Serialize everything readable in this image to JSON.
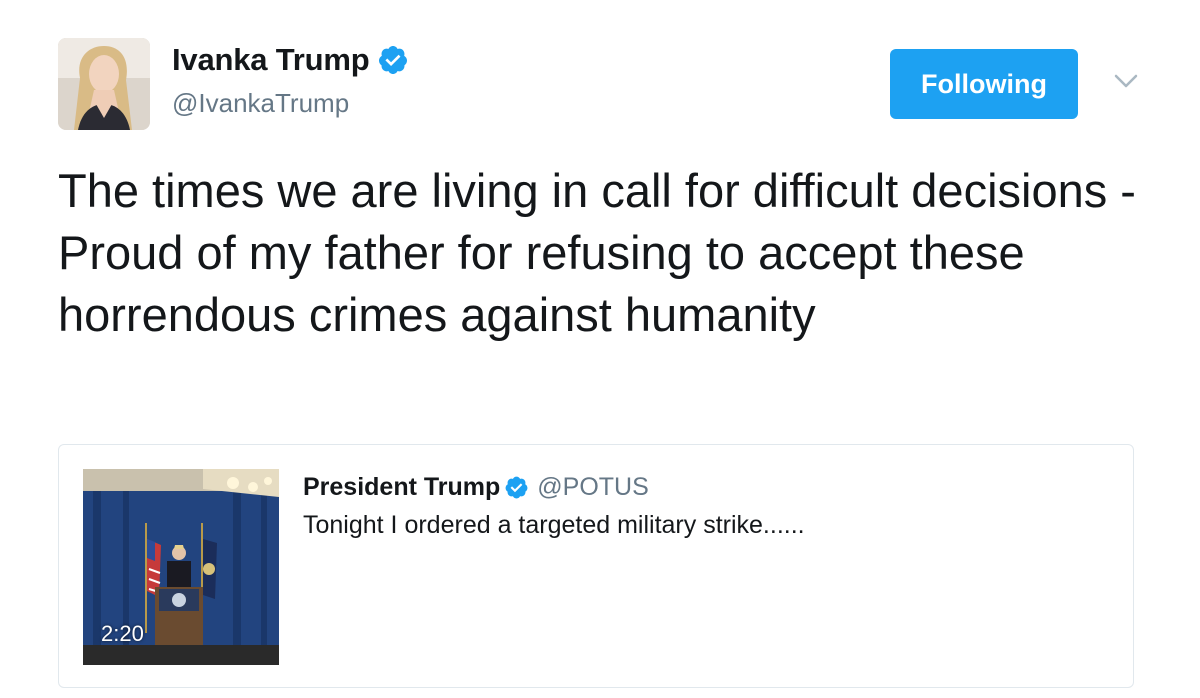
{
  "author": {
    "display_name": "Ivanka Trump",
    "handle": "@IvankaTrump",
    "verified": true,
    "verified_icon": "verified-badge-icon"
  },
  "actions": {
    "follow_label": "Following",
    "menu_icon": "chevron-down-icon"
  },
  "tweet": {
    "text": "The times we are living in call for difficult decisions - Proud of my father for refusing to accept these horrendous crimes against humanity"
  },
  "quoted_tweet": {
    "display_name": "President Trump",
    "handle": "@POTUS",
    "verified": true,
    "text": "Tonight I ordered a targeted military strike......",
    "video_duration": "2:20"
  },
  "colors": {
    "accent": "#1da1f2",
    "muted": "#657786",
    "text": "#14171a",
    "border": "#e1e8ed"
  }
}
